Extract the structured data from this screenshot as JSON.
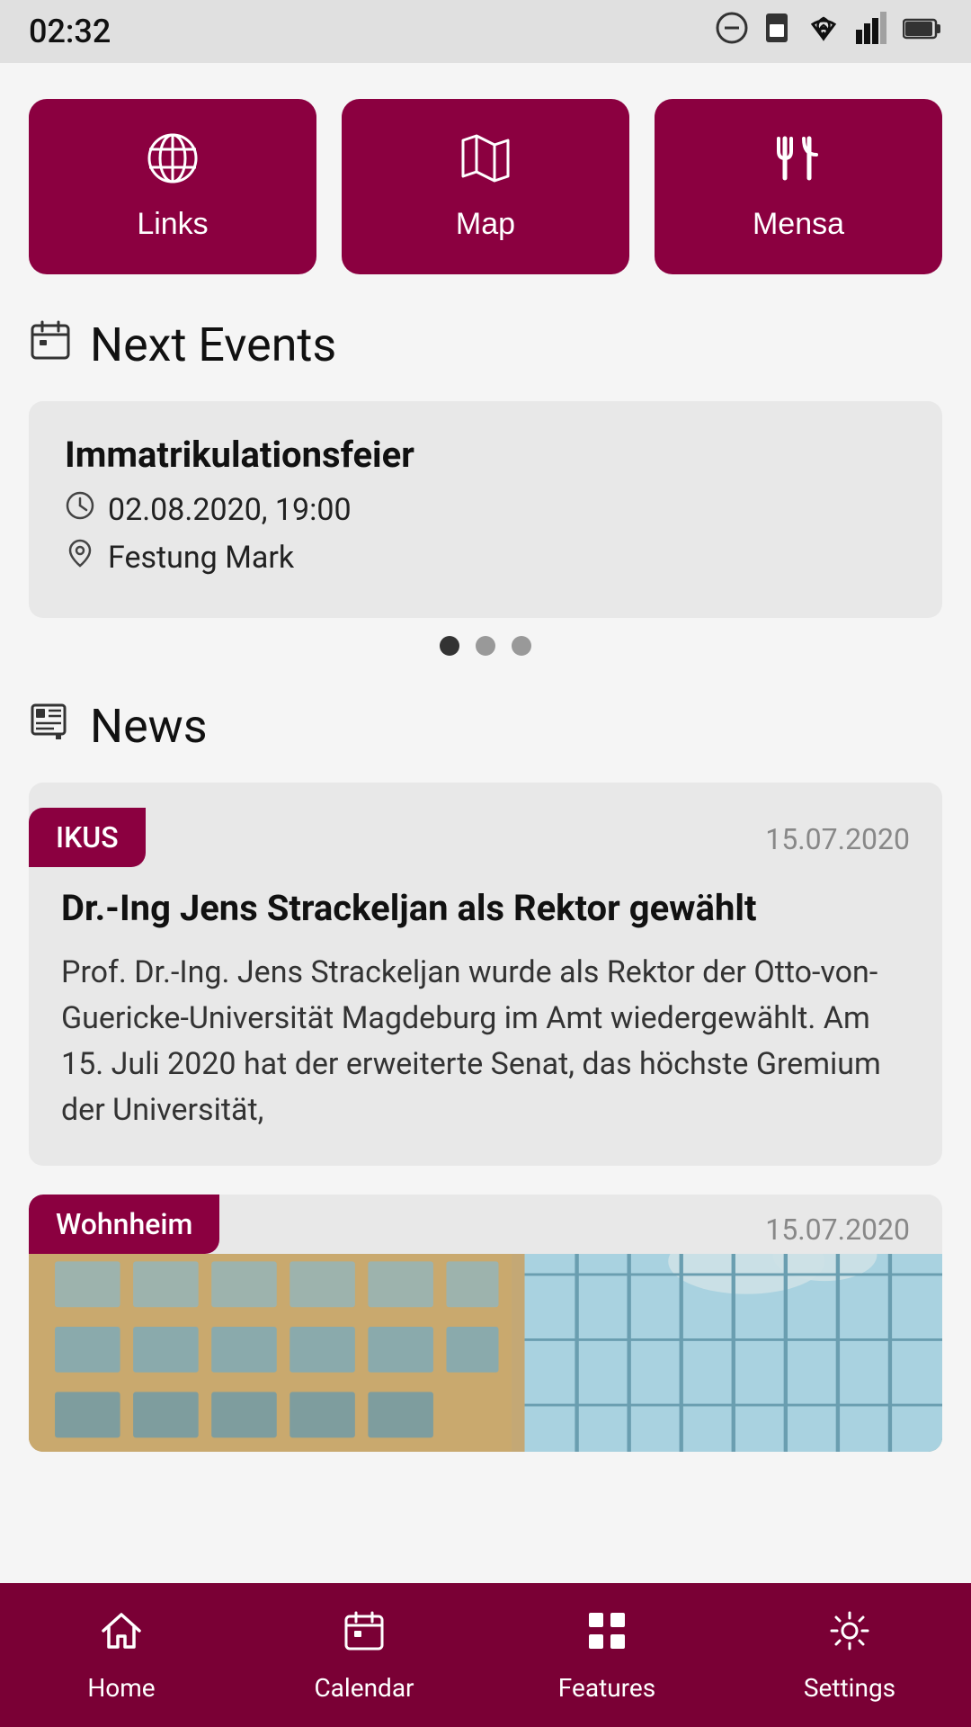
{
  "statusBar": {
    "time": "02:32",
    "icons": [
      "📡",
      "▲",
      "🔋"
    ]
  },
  "quickActions": [
    {
      "id": "links",
      "label": "Links",
      "icon": "🌐"
    },
    {
      "id": "map",
      "label": "Map",
      "icon": "🗺"
    },
    {
      "id": "mensa",
      "label": "Mensa",
      "icon": "🍴"
    }
  ],
  "nextEvents": {
    "sectionTitle": "Next Events",
    "sectionIconLabel": "calendar-icon",
    "events": [
      {
        "title": "Immatrikulationsfeier",
        "datetime": "02.08.2020, 19:00",
        "location": "Festung Mark"
      }
    ],
    "pagination": {
      "total": 3,
      "active": 0
    }
  },
  "news": {
    "sectionTitle": "News",
    "sectionIconLabel": "news-icon",
    "items": [
      {
        "tag": "IKUS",
        "date": "15.07.2020",
        "title": "Dr.-Ing Jens Strackeljan als Rektor gewählt",
        "excerpt": "Prof. Dr.-Ing. Jens Strackeljan wurde als Rektor der Otto-von-Guericke-Universität Magdeburg im Amt wiedergewählt. Am 15. Juli 2020 hat der erweiterte Senat, das höchste Gremium der Universität,"
      },
      {
        "tag": "Wohnheim",
        "date": "15.07.2020",
        "title": "",
        "excerpt": ""
      }
    ]
  },
  "bottomNav": [
    {
      "id": "home",
      "label": "Home",
      "icon": "🏠",
      "active": true
    },
    {
      "id": "calendar",
      "label": "Calendar",
      "icon": "📅",
      "active": false
    },
    {
      "id": "features",
      "label": "Features",
      "icon": "⊞",
      "active": false
    },
    {
      "id": "settings",
      "label": "Settings",
      "icon": "⚙",
      "active": false
    }
  ],
  "colors": {
    "primary": "#8b0040",
    "navBg": "#7a0035"
  }
}
